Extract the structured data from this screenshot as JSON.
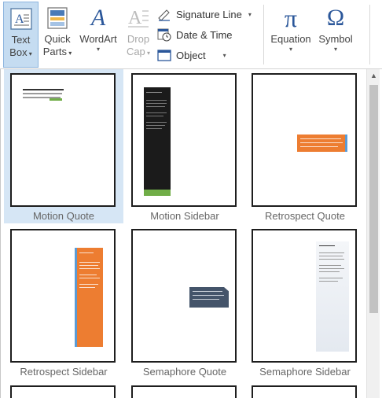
{
  "ribbon": {
    "text_box": "Text",
    "text_box_2": "Box",
    "quick_parts": "Quick",
    "quick_parts_2": "Parts",
    "wordart": "WordArt",
    "drop_cap": "Drop",
    "drop_cap_2": "Cap",
    "signature_line": "Signature Line",
    "date_time": "Date & Time",
    "object": "Object",
    "equation": "Equation",
    "symbol": "Symbol",
    "wordart_glyph": "A",
    "dropcap_glyph": "A",
    "equation_glyph": "π",
    "symbol_glyph": "Ω"
  },
  "gallery": {
    "items": [
      {
        "label": "Motion Quote"
      },
      {
        "label": "Motion Sidebar"
      },
      {
        "label": "Retrospect Quote"
      },
      {
        "label": "Retrospect Sidebar"
      },
      {
        "label": "Semaphore Quote"
      },
      {
        "label": "Semaphore Sidebar"
      }
    ]
  },
  "colors": {
    "accent_orange": "#ed7d31",
    "accent_green": "#70ad47",
    "selected_bg": "#d6e6f5",
    "wordart_blue": "#2b579a",
    "semaphore_slate": "#44546a"
  },
  "icons": [
    "text-box-icon",
    "quick-parts-icon",
    "wordart-icon",
    "drop-cap-icon",
    "signature-line-icon",
    "date-time-icon",
    "object-icon",
    "equation-icon",
    "symbol-icon"
  ]
}
